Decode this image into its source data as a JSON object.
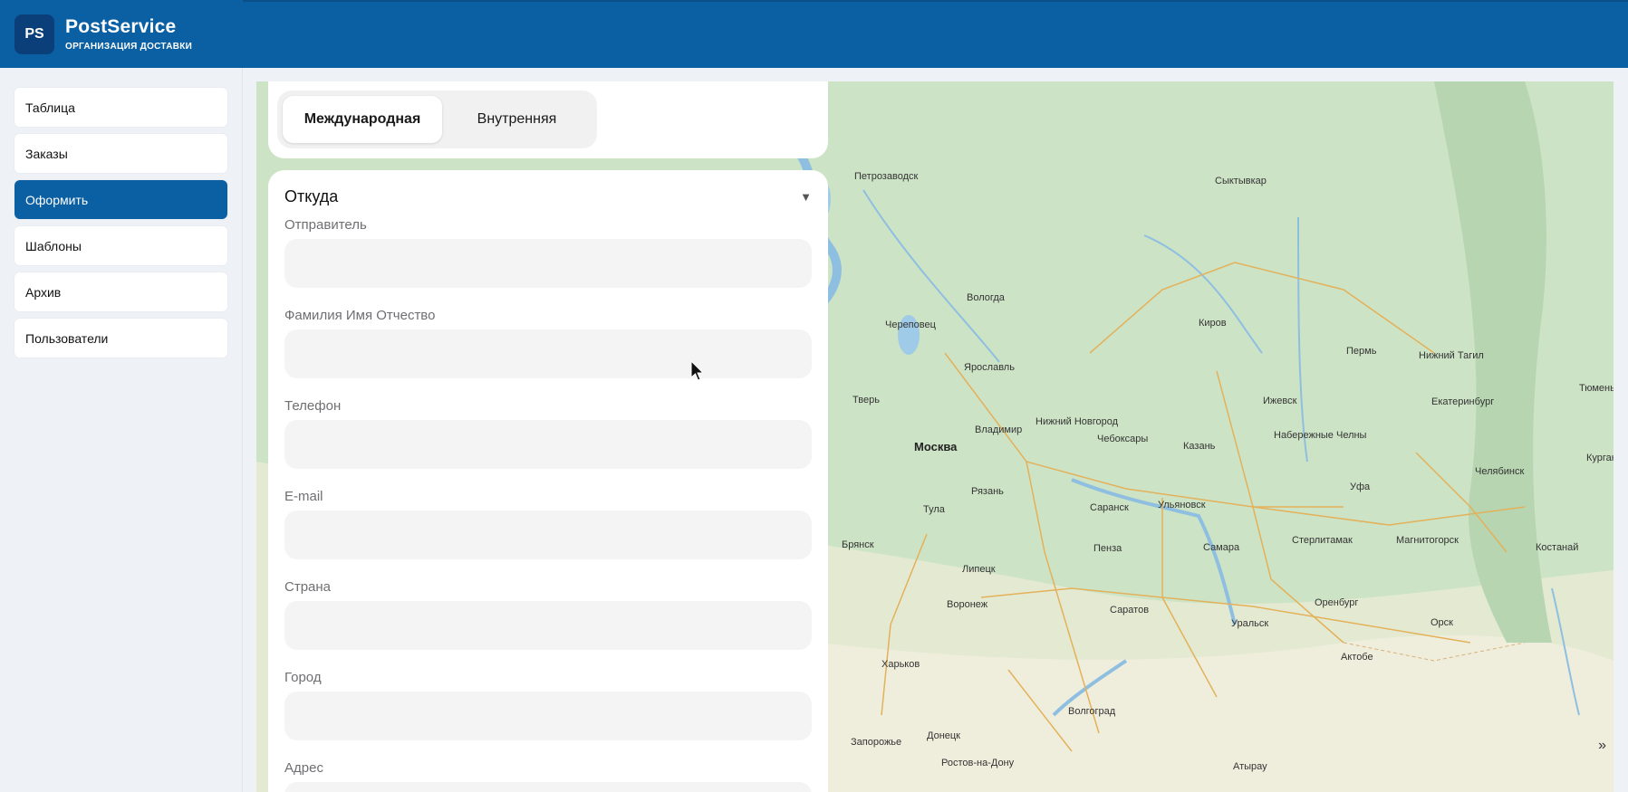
{
  "brand": {
    "logo": "PS",
    "title": "PostService",
    "subtitle": "ОРГАНИЗАЦИЯ ДОСТАВКИ"
  },
  "sidebar": {
    "items": [
      {
        "label": "Таблица",
        "active": false
      },
      {
        "label": "Заказы",
        "active": false
      },
      {
        "label": "Оформить",
        "active": true
      },
      {
        "label": "Шаблоны",
        "active": false
      },
      {
        "label": "Архив",
        "active": false
      },
      {
        "label": "Пользователи",
        "active": false
      }
    ]
  },
  "tabs": {
    "international": "Международная",
    "domestic": "Внутренняя",
    "selected": "international"
  },
  "form": {
    "section_title": "Откуда",
    "chevron": "▼",
    "fields": {
      "sender": {
        "label": "Отправитель",
        "value": ""
      },
      "full_name": {
        "label": "Фамилия Имя Отчество",
        "value": ""
      },
      "phone": {
        "label": "Телефон",
        "value": ""
      },
      "email": {
        "label": "E-mail",
        "value": ""
      },
      "country": {
        "label": "Страна",
        "value": ""
      },
      "city": {
        "label": "Город",
        "value": ""
      },
      "address": {
        "label": "Адрес",
        "value": ""
      }
    }
  },
  "map": {
    "toggle": "»",
    "cities": {
      "petrozavodsk": "Петрозаводск",
      "syktyvkar": "Сыктывкар",
      "vologda": "Вологда",
      "cherepovets": "Череповец",
      "kirov": "Киров",
      "perm": "Пермь",
      "nizhny_tagil": "Нижний Тагил",
      "yaroslavl": "Ярославль",
      "tver": "Тверь",
      "izhevsk": "Ижевск",
      "yekaterinburg": "Екатеринбург",
      "tyumen": "Тюмень",
      "vladimir": "Владимир",
      "nizhny_novgorod": "Нижний Новгород",
      "naberezhnye": "Набережные Челны",
      "moscow": "Москва",
      "cheboksary": "Чебоксары",
      "kazan": "Казань",
      "kurgan": "Курган",
      "chelyabinsk": "Челябинск",
      "tula": "Тула",
      "ryazan": "Рязань",
      "saransk": "Саранск",
      "ulyanovsk": "Ульяновск",
      "ufa": "Уфа",
      "bryansk": "Брянск",
      "penza": "Пенза",
      "samara": "Самара",
      "sterlitamak": "Стерлитамак",
      "magnitogorsk": "Магнитогорск",
      "kostanay": "Костанай",
      "lipetsk": "Липецк",
      "voronezh": "Воронеж",
      "saratov": "Саратов",
      "orenburg": "Оренбург",
      "uralsk": "Уральск",
      "orsk": "Орск",
      "kharkov": "Харьков",
      "aktobe": "Актобе",
      "volgograd": "Волгоград",
      "zaporozhye": "Запорожье",
      "donetsk": "Донецк",
      "rostov": "Ростов-на-Дону",
      "atyrau": "Атырау"
    }
  }
}
